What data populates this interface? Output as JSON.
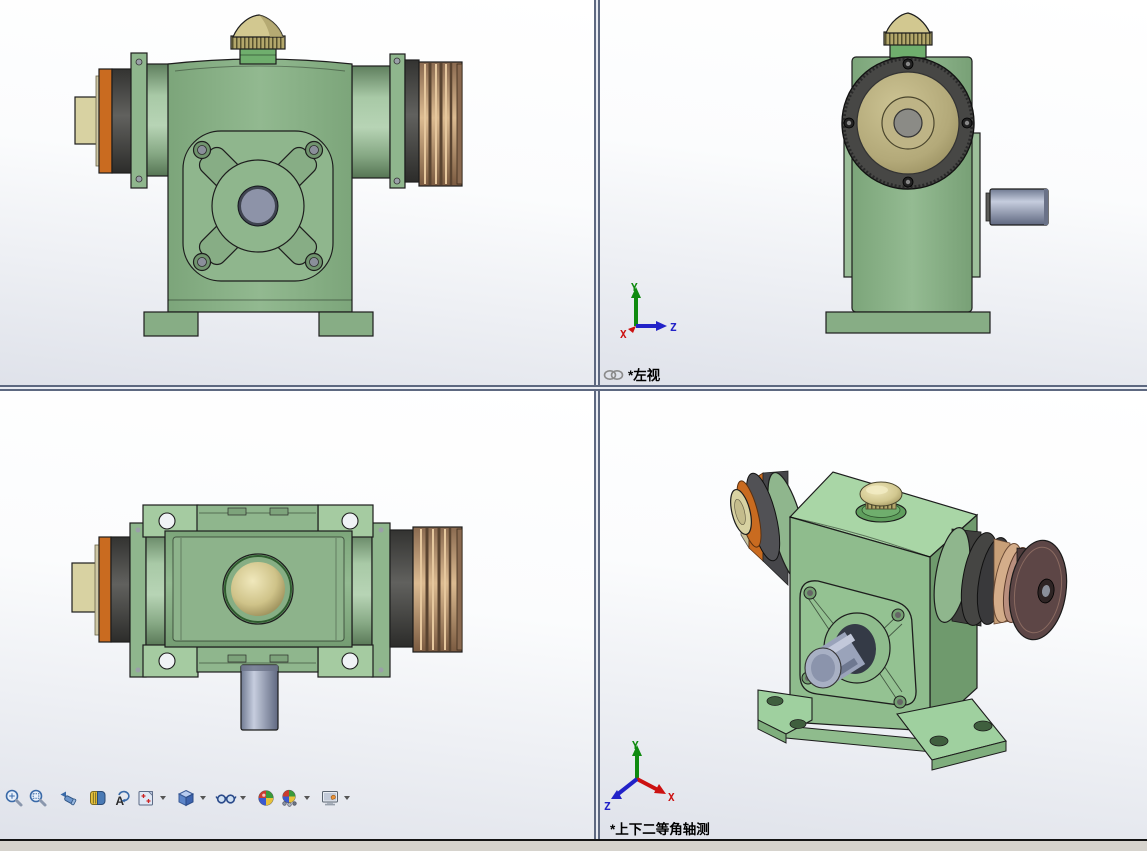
{
  "panes": {
    "top_left": {
      "name": "front-view"
    },
    "top_right": {
      "name": "left-view",
      "label": "*左视"
    },
    "bottom_left": {
      "name": "top-view"
    },
    "bottom_right": {
      "name": "dimetric-view",
      "label": "*上下二等角轴测"
    }
  },
  "toolbar": {
    "rotate_glyph": "A",
    "icons": [
      {
        "name": "zoom-to-fit-icon",
        "has_dropdown": false
      },
      {
        "name": "zoom-to-area-icon",
        "has_dropdown": false
      },
      {
        "name": "previous-view-icon",
        "has_dropdown": false
      },
      {
        "name": "section-view-icon",
        "has_dropdown": false
      },
      {
        "name": "rotate-view-icon",
        "has_dropdown": false
      },
      {
        "name": "view-orientation-icon",
        "has_dropdown": true
      },
      {
        "name": "display-style-icon",
        "has_dropdown": true
      },
      {
        "name": "hide-show-items-icon",
        "has_dropdown": true
      },
      {
        "name": "edit-appearance-icon",
        "has_dropdown": false
      },
      {
        "name": "apply-scene-icon",
        "has_dropdown": true
      },
      {
        "name": "view-settings-icon",
        "has_dropdown": true
      }
    ]
  },
  "triads": {
    "top_right": {
      "x_label": "X",
      "y_label": "Y",
      "z_label": "Z"
    },
    "bottom_right": {
      "x_label": "X",
      "y_label": "Y",
      "z_label": "Z"
    }
  },
  "colors": {
    "housing": "#87ad85",
    "housing-light": "#9cbf9a",
    "housing-pale": "#a5cba1",
    "iso-top": "#a9d6a6",
    "iso-front": "#8fbc8d",
    "iso-side": "#6f9a6d",
    "feet-iso": "#9fd09f",
    "flange": "#8fb68d",
    "coupling-dark": "#4c4c4a",
    "orange-ring": "#c96b20",
    "beige": "#d8d2a2",
    "brass": "#b3a76b",
    "brass-dome": "#d2c890",
    "khaki-face": "#b3a979",
    "shaft": "#9aa3ba",
    "pulley-tan": "#c8a078",
    "pulley-brown": "#5d4646",
    "outline": "#1d1d1d",
    "bg-top": "#ffffff",
    "bg-bottom": "#dfe2ea",
    "divider-dark": "#5d6880",
    "divider-light": "#e8ebf2",
    "axis-x": "#cc1111",
    "axis-y": "#0f8a0f",
    "axis-z": "#2222c8",
    "label-text": "#000000",
    "status-bar": "#d6d3cd"
  }
}
